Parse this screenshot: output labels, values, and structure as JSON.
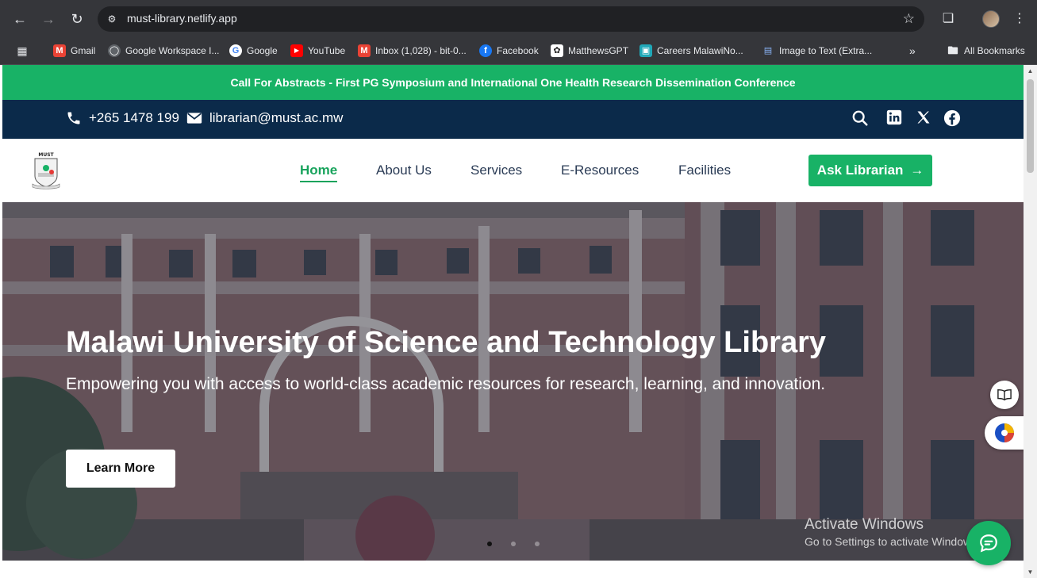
{
  "browser": {
    "url": "must-library.netlify.app",
    "bookmarks": [
      {
        "label": "Gmail",
        "icon": "gmail-icon"
      },
      {
        "label": "Google Workspace I...",
        "icon": "google-workspace-icon"
      },
      {
        "label": "Google",
        "icon": "google-icon"
      },
      {
        "label": "YouTube",
        "icon": "youtube-icon"
      },
      {
        "label": "Inbox (1,028) - bit-0...",
        "icon": "gmail-icon"
      },
      {
        "label": "Facebook",
        "icon": "facebook-icon"
      },
      {
        "label": "MatthewsGPT",
        "icon": "chatgpt-icon"
      },
      {
        "label": "Careers MalawiNo...",
        "icon": "careers-icon"
      },
      {
        "label": "Image to Text (Extra...",
        "icon": "image-to-text-icon"
      }
    ],
    "all_bookmarks_label": "All Bookmarks"
  },
  "announcement": "Call For Abstracts - First PG Symposium and International One Health Research Dissemination Conference",
  "contact": {
    "phone": "+265 1478 199",
    "email": "librarian@must.ac.mw"
  },
  "nav": {
    "items": [
      "Home",
      "About Us",
      "Services",
      "E-Resources",
      "Facilities"
    ],
    "active": "Home",
    "cta": "Ask Librarian"
  },
  "hero": {
    "title": "Malawi University of Science and Technology Library",
    "subtitle": "Empowering you with access to world-class academic resources for research, learning, and innovation.",
    "button": "Learn More",
    "slides": 3,
    "active_slide": 1
  },
  "os_watermark": {
    "title": "Activate Windows",
    "subtitle": "Go to Settings to activate Windows."
  },
  "colors": {
    "accent": "#18b266",
    "navy": "#0b2a4a",
    "chrome": "#35363a"
  }
}
